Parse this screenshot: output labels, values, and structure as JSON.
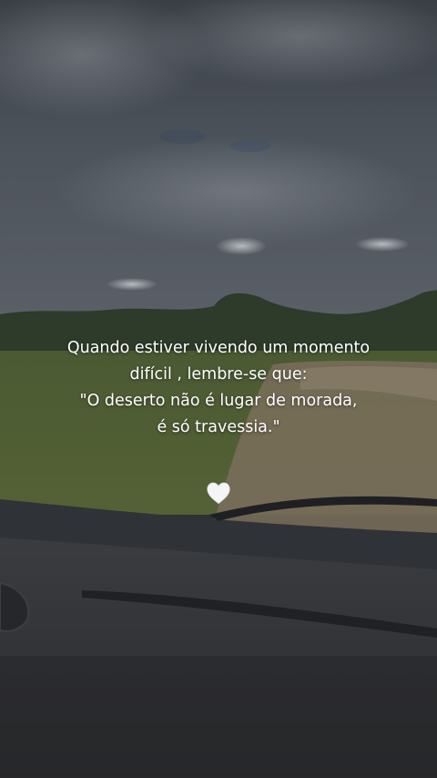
{
  "quote": {
    "lines": [
      "Quando estiver vivendo um momento",
      "difícil , lembre-se que:",
      "\"O deserto não é lugar de morada,",
      "é só travessia.\""
    ]
  },
  "decoration": {
    "icon": "white-heart-icon",
    "color": "#f5f5f5"
  },
  "scene": {
    "sky_color": "#4a5058",
    "field_color": "#5d6b3a",
    "road_color": "#8a7a64",
    "dashboard_color": "#2f3135"
  }
}
